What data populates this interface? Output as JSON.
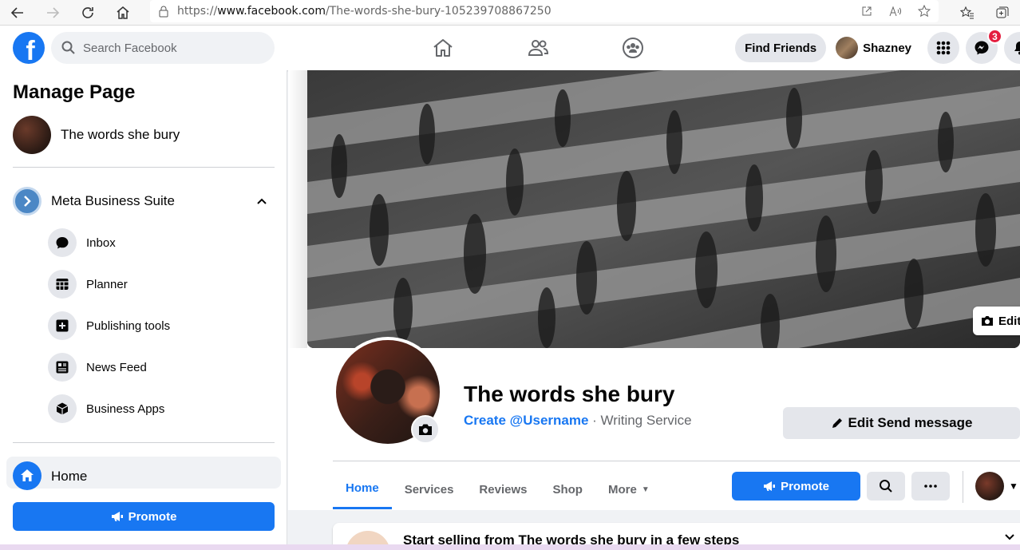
{
  "browser": {
    "url_prefix": "https://",
    "url_host": "www.facebook.com",
    "url_path": "/The-words-she-bury-105239708867250"
  },
  "header": {
    "search_placeholder": "Search Facebook",
    "find_friends": "Find Friends",
    "profile_name": "Shazney",
    "messenger_badge": "3"
  },
  "sidebar": {
    "title": "Manage Page",
    "page_name": "The words she bury",
    "suite_label": "Meta Business Suite",
    "items": [
      {
        "label": "Inbox",
        "icon": "chat-bubble-icon"
      },
      {
        "label": "Planner",
        "icon": "calendar-grid-icon"
      },
      {
        "label": "Publishing tools",
        "icon": "publishing-tools-icon"
      },
      {
        "label": "News Feed",
        "icon": "news-feed-icon"
      },
      {
        "label": "Business Apps",
        "icon": "cube-icon"
      }
    ],
    "home_label": "Home",
    "promote_label": "Promote"
  },
  "main": {
    "edit_cover_label": "Edit",
    "page_name": "The words she bury",
    "create_username": "Create @Username",
    "separator": " · ",
    "category": "Writing Service",
    "edit_send_label": "Edit Send message",
    "tabs": [
      {
        "label": "Home",
        "active": true
      },
      {
        "label": "Services",
        "active": false
      },
      {
        "label": "Reviews",
        "active": false
      },
      {
        "label": "Shop",
        "active": false
      },
      {
        "label": "More",
        "active": false
      }
    ],
    "promote_label": "Promote",
    "sell_card_text": "Start selling from The words she bury in a few steps"
  },
  "colors": {
    "brand_blue": "#1877f2",
    "badge_red": "#e41e3f",
    "button_grey": "#e4e6eb"
  }
}
